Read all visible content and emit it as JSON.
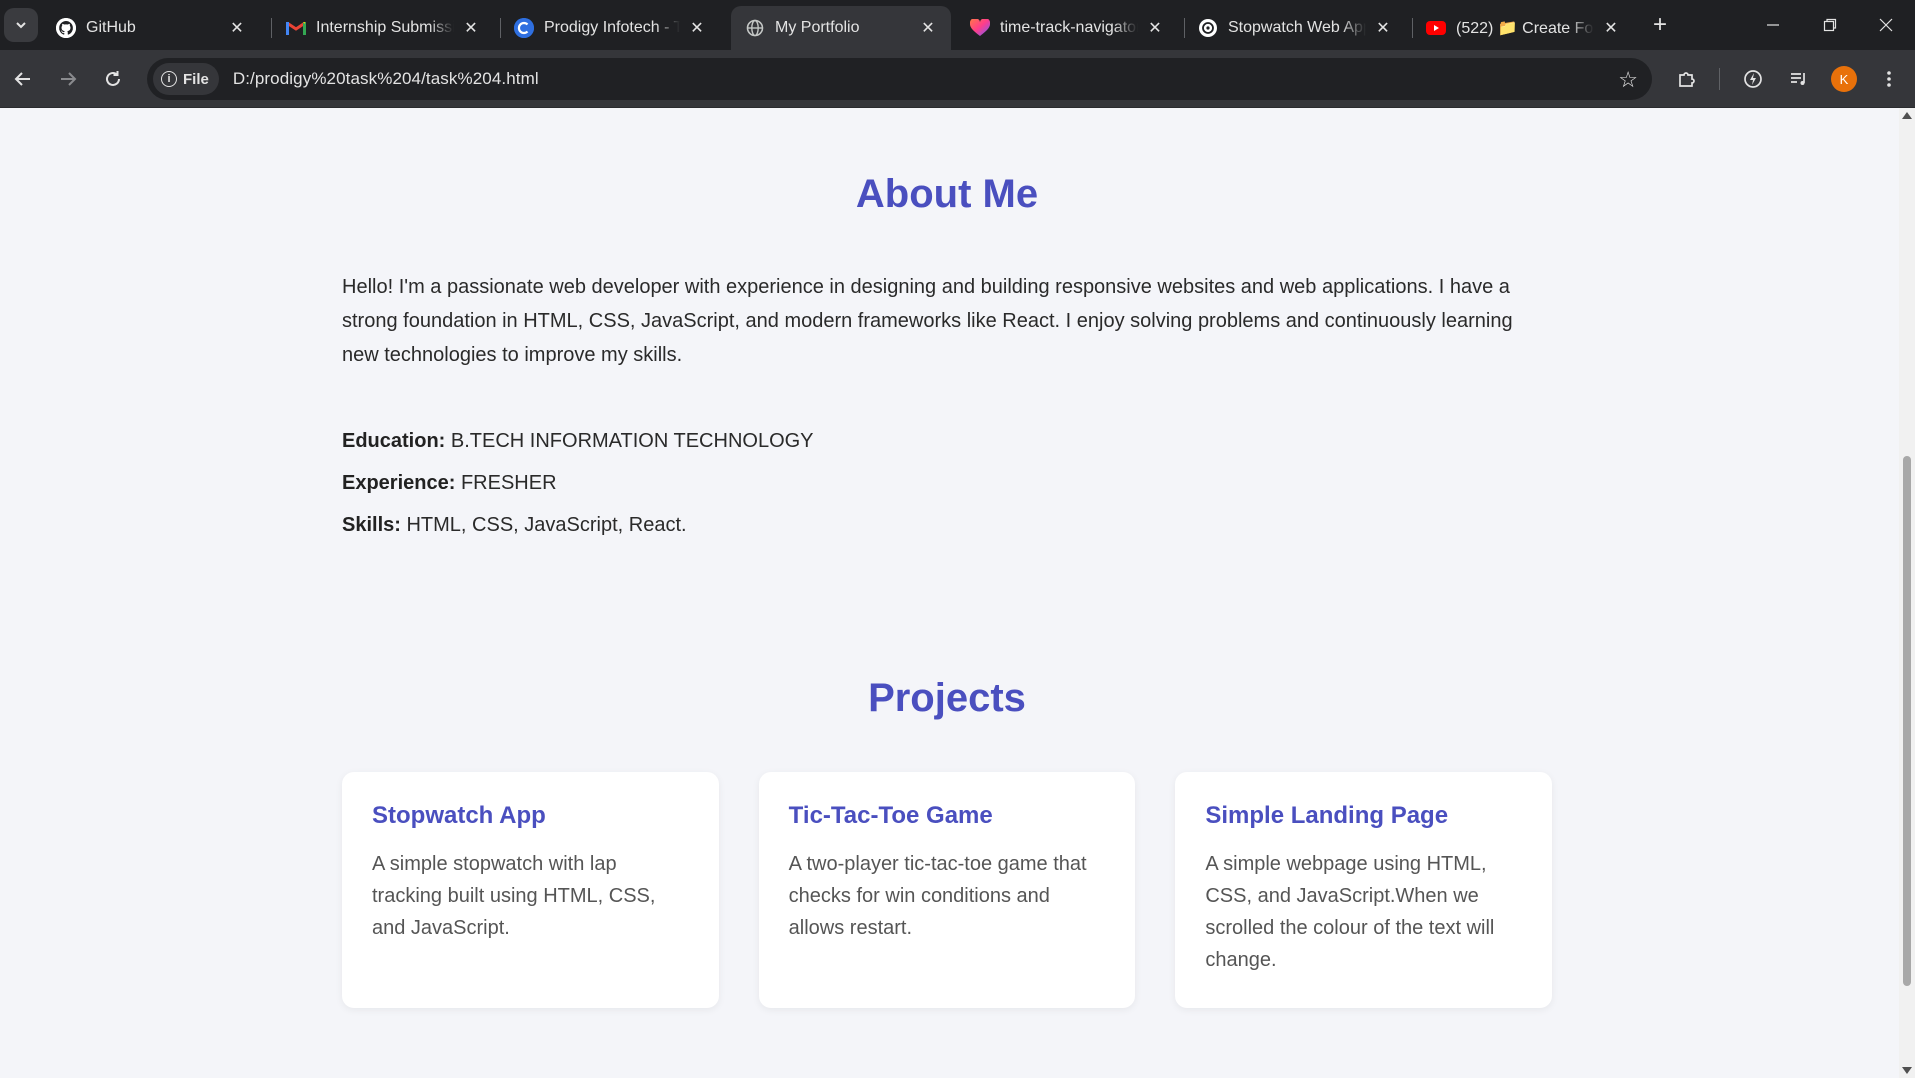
{
  "browser": {
    "tabs": [
      {
        "title": "GitHub",
        "active": false
      },
      {
        "title": "Internship Submission",
        "active": false
      },
      {
        "title": "Prodigy Infotech - Task",
        "active": false
      },
      {
        "title": "My Portfolio",
        "active": true
      },
      {
        "title": "time-track-navigator",
        "active": false
      },
      {
        "title": "Stopwatch Web App",
        "active": false
      },
      {
        "title": "(522) 📁 Create Folder",
        "active": false
      }
    ],
    "site_chip": "File",
    "url": "D:/prodigy%20task%204/task%204.html",
    "profile_initial": "K",
    "colors": {
      "accent": "#4a4fbf",
      "avatar": "#e8710a",
      "youtube": "#ff0000"
    }
  },
  "about": {
    "title": "About Me",
    "text": "Hello! I'm a passionate web developer with experience in designing and building responsive websites and web applications. I have a strong foundation in HTML, CSS, JavaScript, and modern frameworks like React. I enjoy solving problems and continuously learning new technologies to improve my skills.",
    "education_label": "Education:",
    "education_value": "B.TECH INFORMATION TECHNOLOGY",
    "experience_label": "Experience:",
    "experience_value": "FRESHER",
    "skills_label": "Skills:",
    "skills_value": "HTML, CSS, JavaScript, React."
  },
  "projects": {
    "title": "Projects",
    "items": [
      {
        "name": "Stopwatch App",
        "description": "A simple stopwatch with lap tracking built using HTML, CSS, and JavaScript."
      },
      {
        "name": "Tic-Tac-Toe Game",
        "description": "A two-player tic-tac-toe game that checks for win conditions and allows restart."
      },
      {
        "name": "Simple Landing Page",
        "description": "A simple webpage using HTML, CSS, and JavaScript.When we scrolled the colour of the text will change."
      }
    ]
  }
}
